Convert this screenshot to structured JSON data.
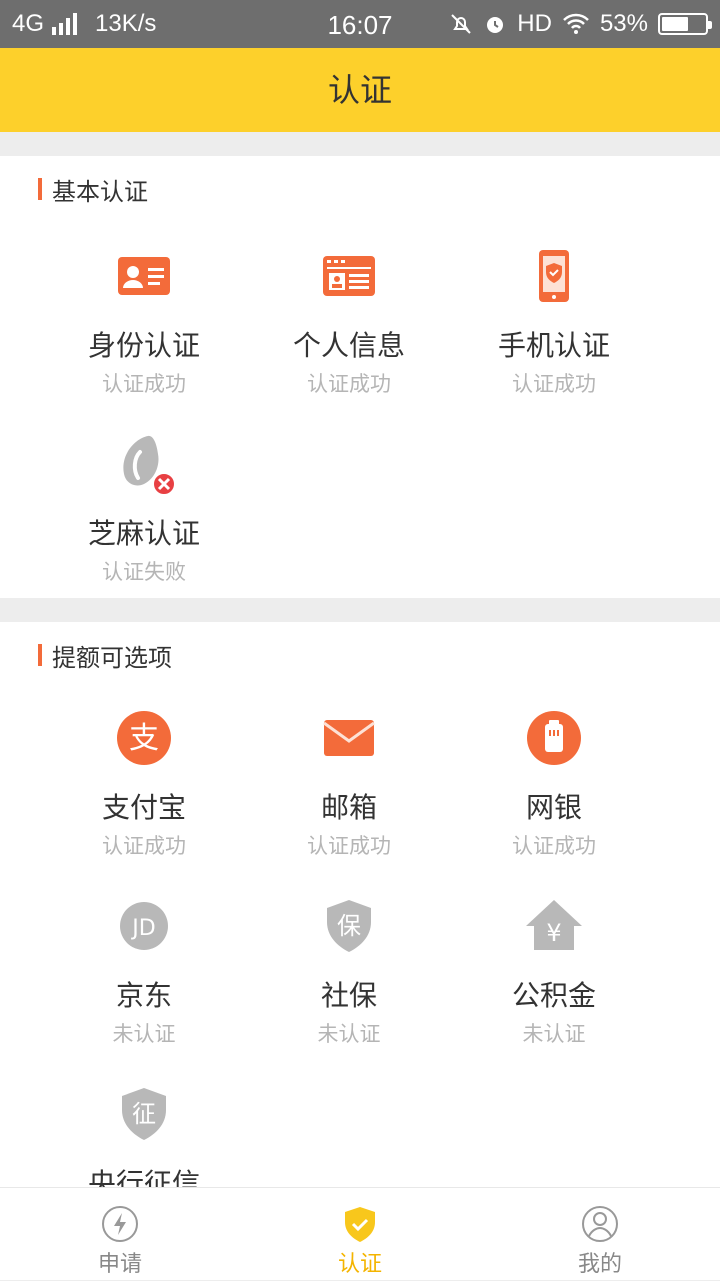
{
  "status_bar": {
    "network": "4G",
    "speed": "13K/s",
    "time": "16:07",
    "hd": "HD",
    "battery": "53%"
  },
  "header": {
    "title": "认证"
  },
  "basic": {
    "title": "基本认证",
    "items": [
      {
        "label": "身份认证",
        "status": "认证成功",
        "icon": "id-card-icon"
      },
      {
        "label": "个人信息",
        "status": "认证成功",
        "icon": "personal-info-icon"
      },
      {
        "label": "手机认证",
        "status": "认证成功",
        "icon": "phone-icon"
      },
      {
        "label": "芝麻认证",
        "status": "认证失败",
        "icon": "sesame-icon"
      }
    ]
  },
  "optional": {
    "title": "提额可选项",
    "items": [
      {
        "label": "支付宝",
        "status": "认证成功",
        "icon": "alipay-icon",
        "glyph": "支"
      },
      {
        "label": "邮箱",
        "status": "认证成功",
        "icon": "mail-icon"
      },
      {
        "label": "网银",
        "status": "认证成功",
        "icon": "bank-card-icon"
      },
      {
        "label": "京东",
        "status": "未认证",
        "icon": "jd-icon",
        "glyph": "JD"
      },
      {
        "label": "社保",
        "status": "未认证",
        "icon": "social-security-icon",
        "glyph": "保"
      },
      {
        "label": "公积金",
        "status": "未认证",
        "icon": "housing-fund-icon",
        "glyph": "¥"
      },
      {
        "label": "央行征信",
        "status": "",
        "icon": "credit-report-icon",
        "glyph": "征"
      }
    ]
  },
  "tabbar": {
    "tabs": [
      {
        "label": "申请",
        "icon": "lightning-icon"
      },
      {
        "label": "认证",
        "icon": "shield-check-icon"
      },
      {
        "label": "我的",
        "icon": "user-icon"
      }
    ]
  },
  "colors": {
    "accent": "#fdd02b",
    "orange": "#f36b3a",
    "gray_icon": "#b8b8b8",
    "active_tab": "#f4b400"
  }
}
